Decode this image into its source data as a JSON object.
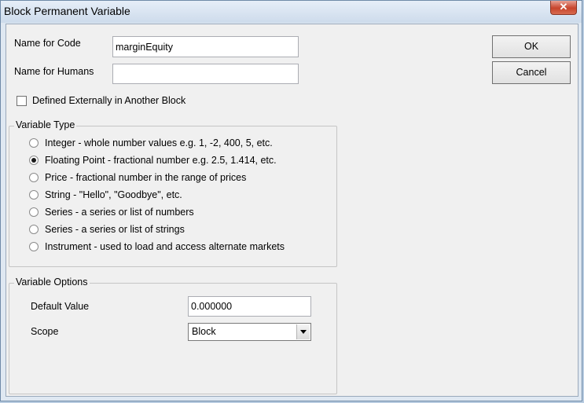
{
  "window": {
    "title": "Block Permanent Variable",
    "close_label": "✕"
  },
  "fields": {
    "name_for_code_label": "Name for Code",
    "name_for_code_value": "marginEquity",
    "name_for_humans_label": "Name for Humans",
    "name_for_humans_value": ""
  },
  "defined_externally": {
    "label": "Defined Externally in Another Block",
    "checked": false
  },
  "variable_type": {
    "legend": "Variable Type",
    "selected_index": 1,
    "options": [
      "Integer - whole number values e.g. 1, -2, 400, 5, etc.",
      "Floating Point - fractional number e.g. 2.5, 1.414, etc.",
      "Price - fractional number in the range of prices",
      "String - \"Hello\", \"Goodbye\", etc.",
      "Series - a series or list of numbers",
      "Series - a series or list of strings",
      "Instrument - used to load and access alternate markets"
    ]
  },
  "variable_options": {
    "legend": "Variable Options",
    "default_value_label": "Default Value",
    "default_value": "0.000000",
    "scope_label": "Scope",
    "scope_value": "Block"
  },
  "buttons": {
    "ok": "OK",
    "cancel": "Cancel"
  }
}
